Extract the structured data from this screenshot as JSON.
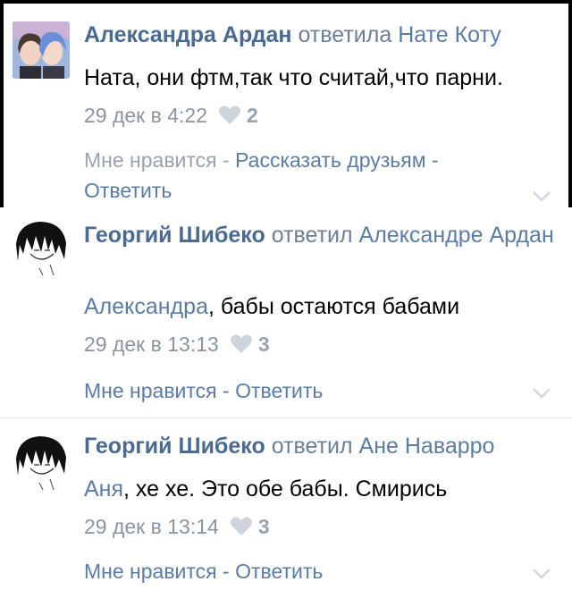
{
  "comments": [
    {
      "author": "Александра Ардан",
      "verb": "ответила",
      "reply_to": "Нате Коту",
      "text": "Ната, они фтм,так что считай,что парни.",
      "time": "29 дек в 4:22",
      "likes": "2",
      "actions": {
        "like": "Мне нравится",
        "sep": " - ",
        "share": "Рассказать друзьям",
        "reply": "Ответить"
      }
    },
    {
      "author": "Георгий Шибеко",
      "verb": "ответил",
      "reply_to": "Александре Ардан",
      "mention": "Александра",
      "text": ", бабы остаются бабами",
      "time": "29 дек в 13:13",
      "likes": "3",
      "actions": {
        "like": "Мне нравится",
        "sep": " - ",
        "reply": "Ответить"
      }
    },
    {
      "author": "Георгий Шибеко",
      "verb": "ответил",
      "reply_to": "Ане Наварро",
      "mention": "Аня",
      "text": ", хе хе. Это обе бабы. Смирись",
      "time": "29 дек в 13:14",
      "likes": "3",
      "actions": {
        "like": "Мне нравится",
        "sep": " - ",
        "reply": "Ответить"
      }
    }
  ],
  "icons": {
    "like": "heart-icon",
    "expand": "chevron-down-icon"
  },
  "colors": {
    "link": "#5b7ca6",
    "author": "#4a6a92",
    "meta": "#8b959f",
    "frame": "#000000"
  }
}
